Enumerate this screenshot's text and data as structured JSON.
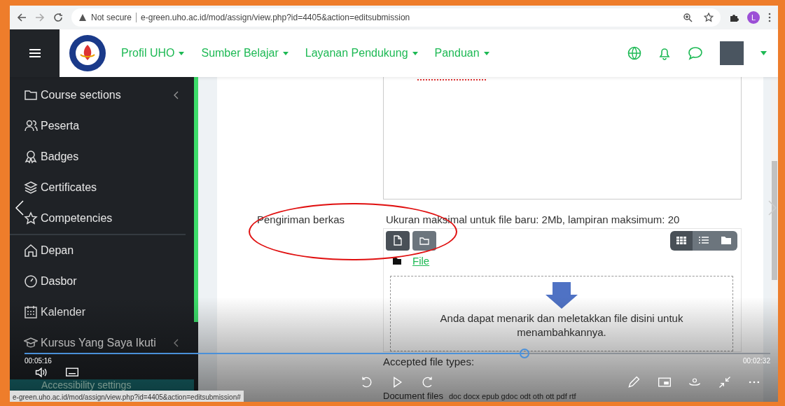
{
  "browser": {
    "security": "Not secure",
    "url": "e-green.uho.ac.id/mod/assign/view.php?id=4405&action=editsubmission",
    "profile_initial": "L"
  },
  "navbar": {
    "menus": [
      {
        "label": "Profil UHO"
      },
      {
        "label": "Sumber Belajar"
      },
      {
        "label": "Layanan Pendukung"
      },
      {
        "label": "Panduan"
      }
    ]
  },
  "sidebar": {
    "items": [
      {
        "label": "Course sections",
        "kind": "folder",
        "expandable": true
      },
      {
        "label": "Peserta",
        "kind": "people",
        "expandable": false
      },
      {
        "label": "Badges",
        "kind": "badge",
        "expandable": false
      },
      {
        "label": "Certificates",
        "kind": "layers",
        "expandable": false
      },
      {
        "label": "Competencies",
        "kind": "star",
        "expandable": false
      },
      {
        "label": "Depan",
        "kind": "home",
        "expandable": false
      },
      {
        "label": "Dasbor",
        "kind": "gauge",
        "expandable": false
      },
      {
        "label": "Kalender",
        "kind": "calendar",
        "expandable": false
      },
      {
        "label": "Kursus Yang Saya Ikuti",
        "kind": "cap",
        "expandable": true
      }
    ],
    "accessibility": "Accessibility settings"
  },
  "submission": {
    "label": "Pengiriman berkas",
    "limits": "Ukuran maksimal untuk file baru: 2Mb, lampiran maksimum: 20",
    "path": "File",
    "view_buttons": [
      {
        "kind": "grid",
        "selected": true
      },
      {
        "kind": "list",
        "selected": false
      },
      {
        "kind": "folder",
        "selected": false
      }
    ],
    "drop_text": "Anda dapat menarik dan meletakkan file disini untuk menambahkannya.",
    "accepted_label": "Accepted file types:",
    "file_types": [
      {
        "name": "Document files",
        "extensions": "doc docx epub gdoc odt oth ott pdf rtf"
      }
    ]
  },
  "video": {
    "elapsed": "00:05:16",
    "remaining": "00:02:32",
    "level": 0.67
  },
  "status_url": "e-green.uho.ac.id/mod/assign/view.php?id=4405&action=editsubmission#"
}
